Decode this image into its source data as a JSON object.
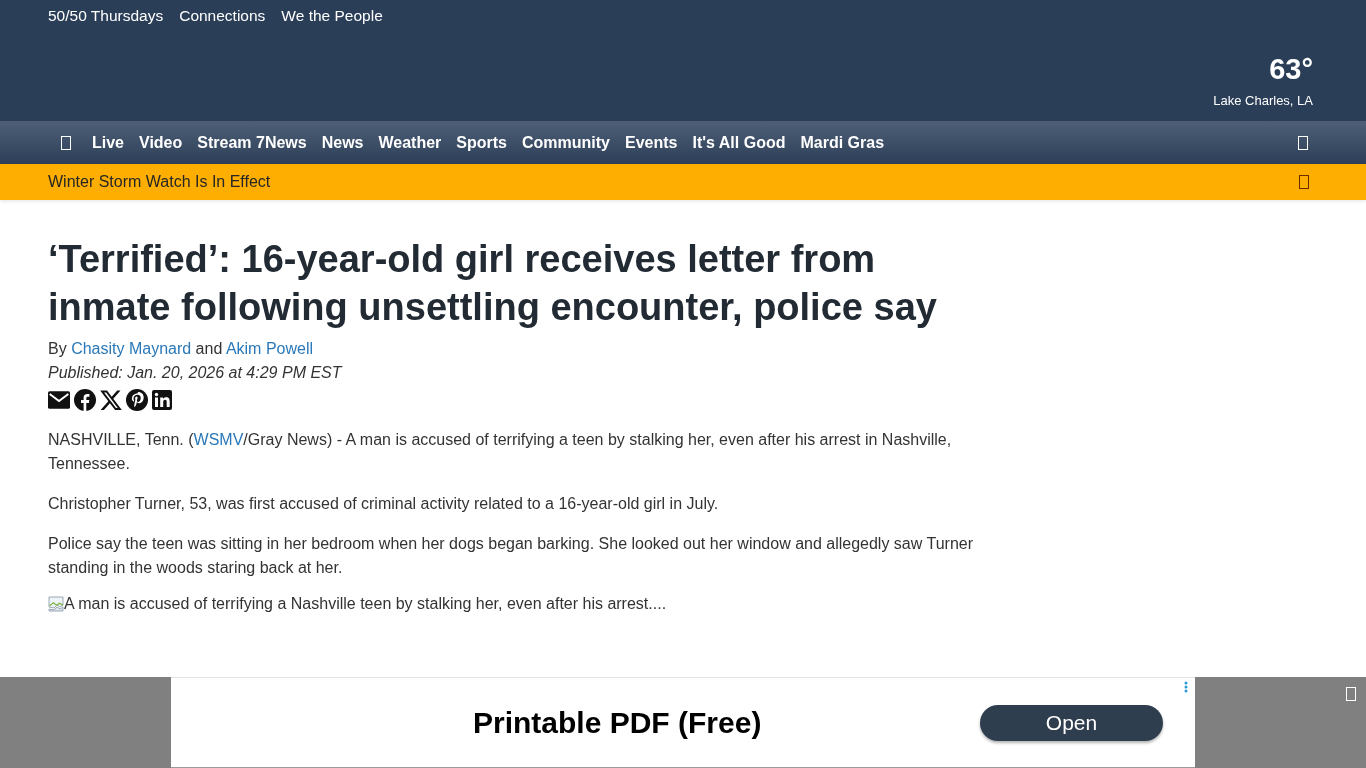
{
  "top_links": [
    {
      "label": "50/50 Thursdays"
    },
    {
      "label": "Connections"
    },
    {
      "label": "We the People"
    }
  ],
  "weather": {
    "temperature": "63°",
    "location": "Lake Charles, LA"
  },
  "nav": {
    "items": [
      {
        "label": "Live"
      },
      {
        "label": "Video"
      },
      {
        "label": "Stream 7News"
      },
      {
        "label": "News"
      },
      {
        "label": "Weather"
      },
      {
        "label": "Sports"
      },
      {
        "label": "Community"
      },
      {
        "label": "Events"
      },
      {
        "label": "It's All Good"
      },
      {
        "label": "Mardi Gras"
      }
    ]
  },
  "alert": {
    "text": "Winter Storm Watch Is In Effect"
  },
  "article": {
    "headline": "‘Terrified’: 16-year-old girl receives letter from inmate following unsettling encounter, police say",
    "byline": [
      {
        "kind": "text",
        "text": "By "
      },
      {
        "kind": "link",
        "text": "Chasity Maynard"
      },
      {
        "kind": "text",
        "text": " and "
      },
      {
        "kind": "link",
        "text": "Akim Powell"
      }
    ],
    "published": "Published: Jan. 20, 2026 at 4:29 PM EST",
    "paragraphs": [
      {
        "segments": [
          {
            "kind": "text",
            "text": "NASHVILLE, Tenn. ("
          },
          {
            "kind": "link",
            "text": "WSMV"
          },
          {
            "kind": "text",
            "text": "/Gray News) - A man is accused of terrifying a teen by stalking her, even after his arrest in Nashville, Tennessee."
          }
        ]
      },
      {
        "segments": [
          {
            "kind": "text",
            "text": "Christopher Turner, 53, was first accused of criminal activity related to a 16-year-old girl in July."
          }
        ]
      },
      {
        "segments": [
          {
            "kind": "text",
            "text": "Police say the teen was sitting in her bedroom when her dogs began barking. She looked out her window and allegedly saw Turner standing in the woods staring back at her."
          }
        ]
      }
    ],
    "image": {
      "alt": "A man is accused of terrifying a Nashville teen by stalking her, even after his arrest...."
    }
  },
  "ad": {
    "headline": "Printable PDF (Free)",
    "button": "Open"
  }
}
